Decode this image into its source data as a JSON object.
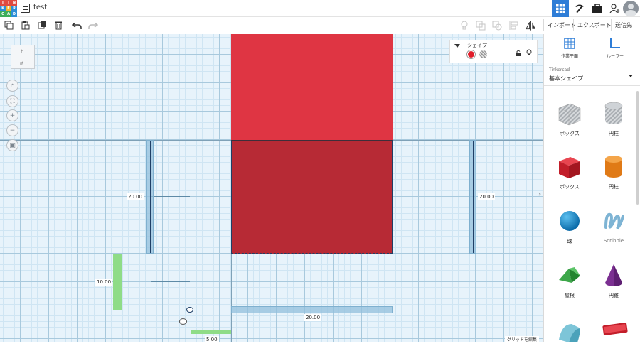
{
  "app": {
    "logo_letters": [
      "T",
      "I",
      "N",
      "K",
      "E",
      "R",
      "C",
      "A",
      "D"
    ],
    "project_name": "test"
  },
  "toolbar": {
    "import": "インポート",
    "export": "エクスポート",
    "send_to": "送信先"
  },
  "view_cube": {
    "top_face": "上",
    "front_face": "前"
  },
  "inspector": {
    "label": "シェイプ",
    "solid_color": "#e01e2b"
  },
  "right_panel": {
    "workplane_tool": "作業平面",
    "ruler_tool": "ルーラー",
    "library_source": "Tinkercad",
    "library_category": "基本シェイプ",
    "shapes": [
      {
        "label": "ボックス",
        "icon": "box-hole-icon"
      },
      {
        "label": "円柱",
        "icon": "cylinder-hole-icon"
      },
      {
        "label": "ボックス",
        "icon": "box-icon"
      },
      {
        "label": "円柱",
        "icon": "cylinder-icon"
      },
      {
        "label": "球",
        "icon": "sphere-icon"
      },
      {
        "label": "Scribble",
        "icon": "scribble-icon"
      },
      {
        "label": "屋根",
        "icon": "roof-icon"
      },
      {
        "label": "円錐",
        "icon": "cone-icon"
      },
      {
        "label": "",
        "icon": "round-roof-icon"
      },
      {
        "label": "",
        "icon": "text-icon"
      }
    ]
  },
  "dimensions": {
    "left_height": "20.00",
    "right_height": "20.00",
    "bottom_width": "20.00",
    "green_y": "10.00",
    "green_x": "5.00"
  },
  "workplane": {
    "edit_grid": "グリッドを編集"
  },
  "colors": {
    "accent": "#2e7dd7",
    "shape_red": "#df3543",
    "shape_red_dark": "#b72a35"
  }
}
